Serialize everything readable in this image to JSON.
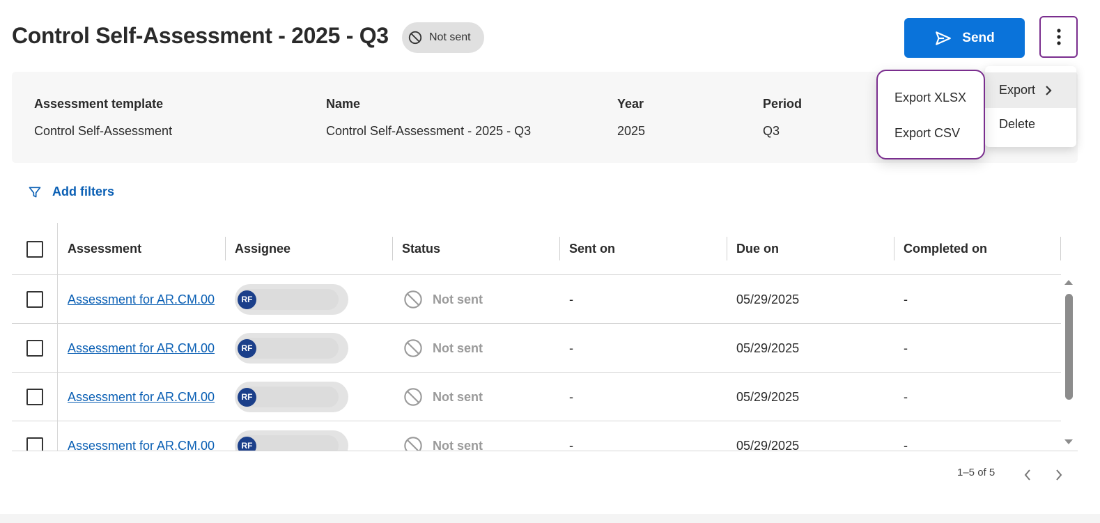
{
  "header": {
    "title": "Control Self-Assessment - 2025 - Q3",
    "status": "Not sent",
    "send_label": "Send"
  },
  "info": [
    {
      "label": "Assessment template",
      "value": "Control Self-Assessment"
    },
    {
      "label": "Name",
      "value": "Control Self-Assessment - 2025 - Q3"
    },
    {
      "label": "Year",
      "value": "2025"
    },
    {
      "label": "Period",
      "value": "Q3"
    }
  ],
  "filters": {
    "add_label": "Add filters"
  },
  "table": {
    "columns": [
      "Assessment",
      "Assignee",
      "Status",
      "Sent on",
      "Due on",
      "Completed on"
    ],
    "rows": [
      {
        "assessment": "Assessment for AR.CM.00",
        "assignee_initials": "RF",
        "status": "Not sent",
        "sent_on": "-",
        "due_on": "05/29/2025",
        "completed_on": "-"
      },
      {
        "assessment": "Assessment for AR.CM.00",
        "assignee_initials": "RF",
        "status": "Not sent",
        "sent_on": "-",
        "due_on": "05/29/2025",
        "completed_on": "-"
      },
      {
        "assessment": "Assessment for AR.CM.00",
        "assignee_initials": "RF",
        "status": "Not sent",
        "sent_on": "-",
        "due_on": "05/29/2025",
        "completed_on": "-"
      },
      {
        "assessment": "Assessment for AR.CM.00",
        "assignee_initials": "RF",
        "status": "Not sent",
        "sent_on": "-",
        "due_on": "05/29/2025",
        "completed_on": "-"
      }
    ]
  },
  "pagination": {
    "range": "1–5 of 5"
  },
  "menu": {
    "items": [
      "Export",
      "Delete"
    ],
    "export_submenu": [
      "Export XLSX",
      "Export CSV"
    ]
  },
  "colors": {
    "primary": "#0a73da",
    "link": "#0a5fb4",
    "focus": "#7a2e8e",
    "avatar": "#1b3f8a"
  }
}
